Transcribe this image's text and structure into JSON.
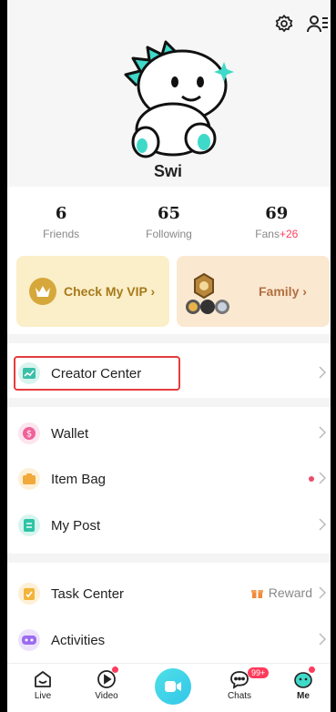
{
  "profile": {
    "username": "Swi"
  },
  "stats": [
    {
      "value": "6",
      "label": "Friends",
      "gain": ""
    },
    {
      "value": "65",
      "label": "Following",
      "gain": ""
    },
    {
      "value": "69",
      "label": "Fans",
      "gain": "+26"
    }
  ],
  "cards": {
    "vip_label": "Check My VIP",
    "family_label": "Family"
  },
  "list": {
    "creator_center": "Creator Center",
    "wallet": "Wallet",
    "item_bag": "Item Bag",
    "my_post": "My Post",
    "task_center": "Task Center",
    "task_reward": "Reward",
    "activities": "Activities"
  },
  "nav": {
    "live": "Live",
    "video": "Video",
    "chats": "Chats",
    "chats_badge": "99+",
    "me": "Me"
  },
  "colors": {
    "accent_red": "#ff3b5c",
    "highlight_border": "#e53c3c",
    "record_button": "#33c6ea",
    "vip_gold": "#d6a83b"
  }
}
